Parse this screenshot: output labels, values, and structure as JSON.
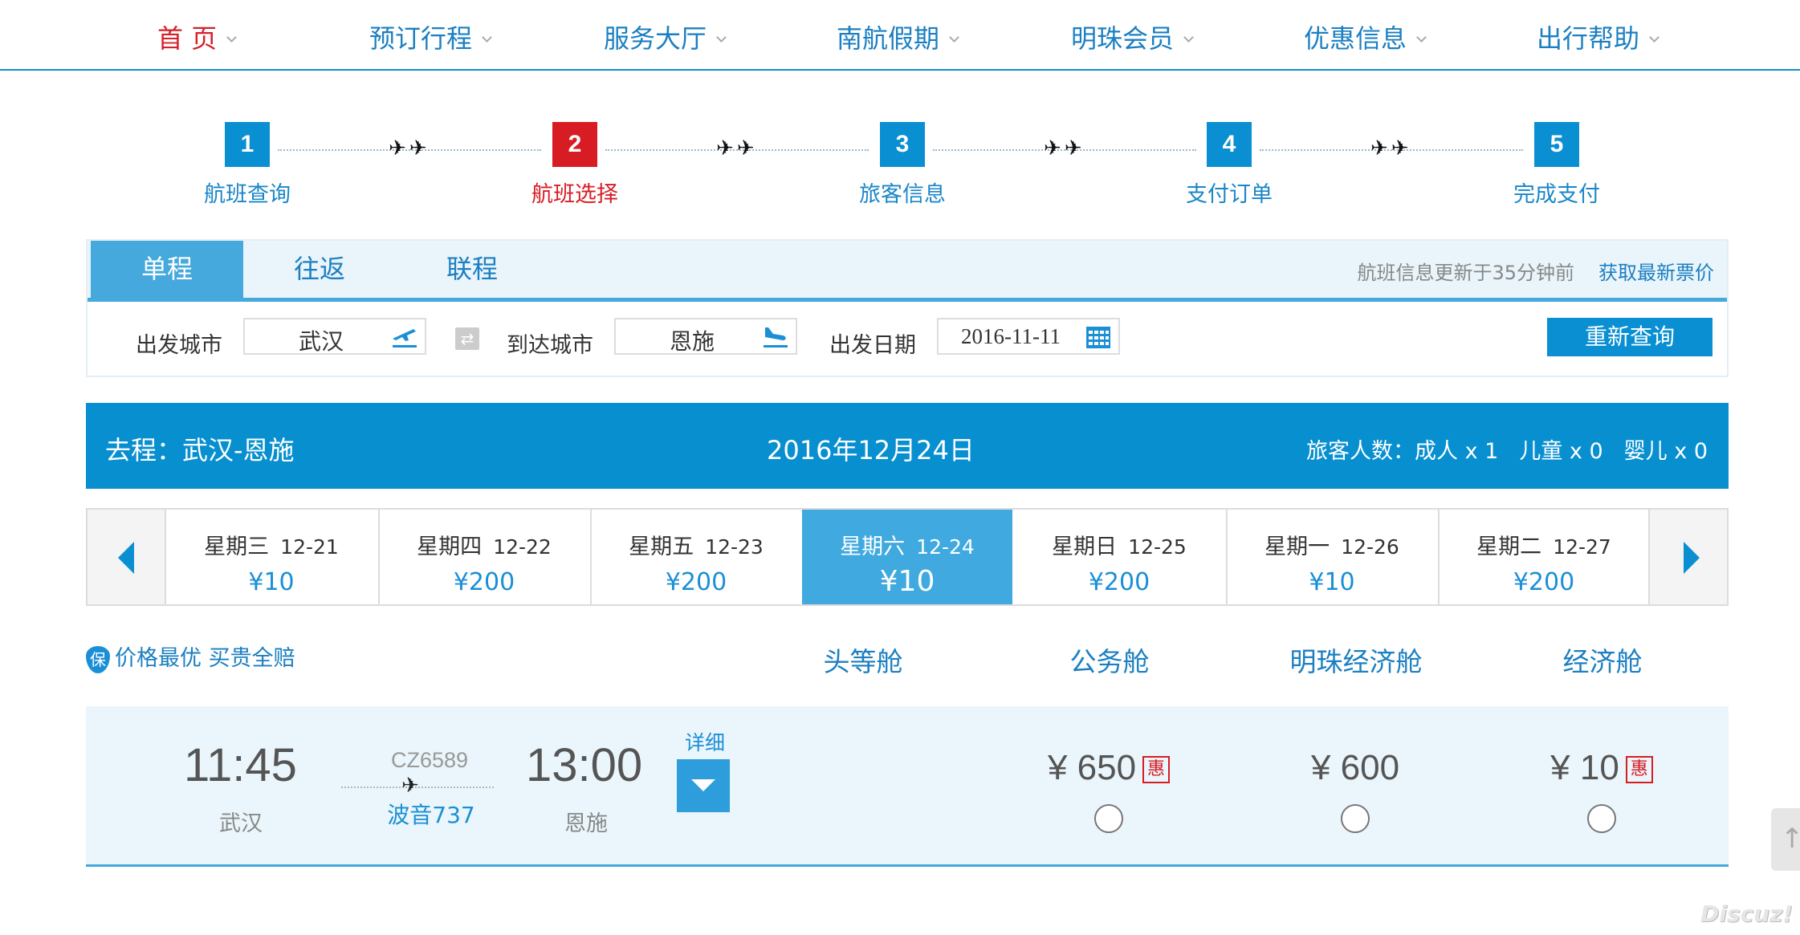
{
  "nav": [
    {
      "label": "首 页"
    },
    {
      "label": "预订行程"
    },
    {
      "label": "服务大厅"
    },
    {
      "label": "南航假期"
    },
    {
      "label": "明珠会员"
    },
    {
      "label": "优惠信息"
    },
    {
      "label": "出行帮助"
    }
  ],
  "steps": [
    {
      "num": "1",
      "label": "航班查询"
    },
    {
      "num": "2",
      "label": "航班选择"
    },
    {
      "num": "3",
      "label": "旅客信息"
    },
    {
      "num": "4",
      "label": "支付订单"
    },
    {
      "num": "5",
      "label": "完成支付"
    }
  ],
  "current_step": "2",
  "search": {
    "tabs": [
      "单程",
      "往返",
      "联程"
    ],
    "active_tab": "单程",
    "update_note": "航班信息更新于35分钟前",
    "refresh_link": "获取最新票价",
    "depart_label": "出发城市",
    "depart_value": "武汉",
    "arrive_label": "到达城市",
    "arrive_value": "恩施",
    "date_label": "出发日期",
    "date_value": "2016-11-11",
    "requery_label": "重新查询"
  },
  "banner": {
    "route": "去程：武汉-恩施",
    "date": "2016年12月24日",
    "pax_label": "旅客人数：",
    "adult": "成人 x 1",
    "child": "儿童 x 0",
    "infant": "婴儿 x 0"
  },
  "dates": [
    {
      "weekday": "星期三",
      "date": "12-21",
      "price": "¥10"
    },
    {
      "weekday": "星期四",
      "date": "12-22",
      "price": "¥200"
    },
    {
      "weekday": "星期五",
      "date": "12-23",
      "price": "¥200"
    },
    {
      "weekday": "星期六",
      "date": "12-24",
      "price": "¥10"
    },
    {
      "weekday": "星期日",
      "date": "12-25",
      "price": "¥200"
    },
    {
      "weekday": "星期一",
      "date": "12-26",
      "price": "¥10"
    },
    {
      "weekday": "星期二",
      "date": "12-27",
      "price": "¥200"
    }
  ],
  "active_date": "12-24",
  "guarantee": {
    "badge": "保",
    "text": "价格最优 买贵全赔"
  },
  "cabins": [
    "头等舱",
    "公务舱",
    "明珠经济舱",
    "经济舱"
  ],
  "flight": {
    "dep_time": "11:45",
    "dep_city": "武汉",
    "flight_no": "CZ6589",
    "aircraft": "波音737",
    "arr_time": "13:00",
    "arr_city": "恩施",
    "detail_label": "详细",
    "fares": {
      "business": {
        "price": "¥ 650",
        "tag": "惠"
      },
      "pearl_economy": {
        "price": "¥ 600"
      },
      "economy": {
        "price": "¥ 10",
        "tag": "惠"
      }
    }
  },
  "side_tab_icon": "up-arrow-icon",
  "watermark": "Discuz!",
  "colors": {
    "brand_blue": "#078fd0",
    "active_red": "#d81c23",
    "light_bg": "#eaf6fb"
  }
}
